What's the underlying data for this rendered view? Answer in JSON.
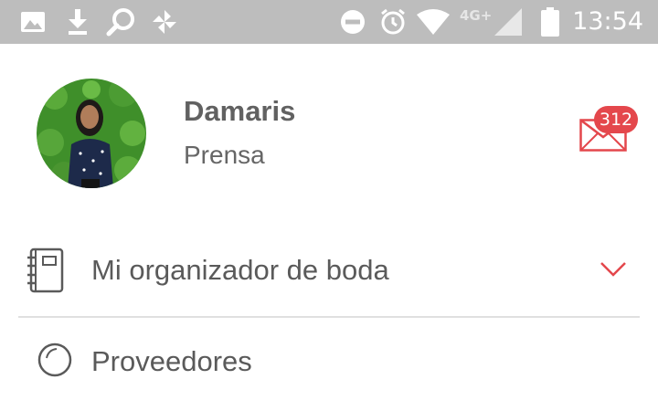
{
  "status_bar": {
    "time": "13:54",
    "network_label": "4G+",
    "icons": [
      "image-icon",
      "download-icon",
      "search-icon",
      "pinwheel-icon",
      "dnd-icon",
      "alarm-icon",
      "wifi-icon",
      "signal-icon",
      "battery-icon"
    ]
  },
  "profile": {
    "name": "Damaris",
    "role": "Prensa"
  },
  "messages": {
    "badge_count": "312",
    "icon": "envelope-icon",
    "accent_color": "#e4474c"
  },
  "menu": {
    "items": [
      {
        "label": "Mi organizador de boda",
        "icon": "notebook-icon",
        "expand_icon": "chevron-down-icon"
      },
      {
        "label": "Proveedores",
        "icon": "search-icon"
      }
    ]
  }
}
